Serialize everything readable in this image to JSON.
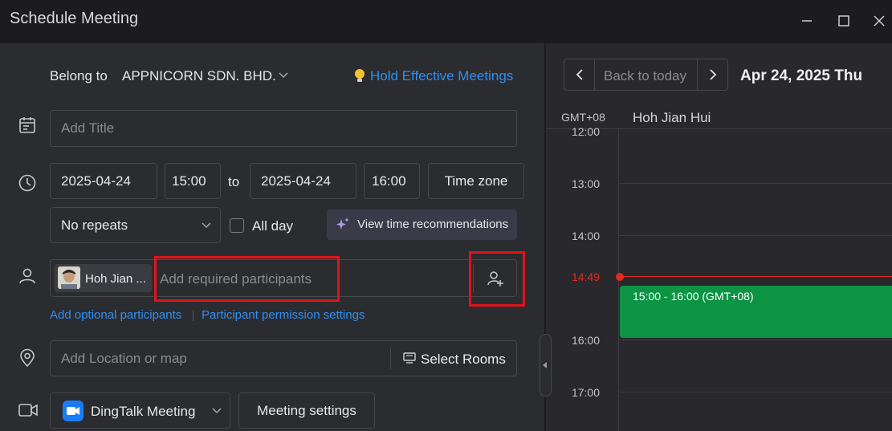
{
  "window": {
    "title": "Schedule Meeting"
  },
  "form": {
    "belong_label": "Belong to",
    "org_name": "APPNICORN SDN. BHD.",
    "tip_link": "Hold Effective Meetings",
    "title_placeholder": "Add Title",
    "start_date": "2025-04-24",
    "start_time": "15:00",
    "to_label": "to",
    "end_date": "2025-04-24",
    "end_time": "16:00",
    "timezone_button": "Time zone",
    "repeat_value": "No repeats",
    "allday_label": "All day",
    "recommend_button": "View time recommendations",
    "participant_chip": "Hoh Jian ...",
    "participants_placeholder": "Add required participants",
    "optional_link": "Add optional participants",
    "permission_link": "Participant permission settings",
    "location_placeholder": "Add Location or map",
    "rooms_button": "Select Rooms",
    "meeting_app": "DingTalk Meeting",
    "meeting_settings": "Meeting settings"
  },
  "calendar": {
    "back_today": "Back to today",
    "date_title": "Apr 24, 2025 Thu",
    "timezone": "GMT+08",
    "person": "Hoh Jian Hui",
    "hours": [
      "12:00",
      "13:00",
      "14:00",
      "16:00",
      "17:00"
    ],
    "now_label": "14:49",
    "event_label": "15:00 - 16:00 (GMT+08)",
    "event_color": "#0c9444",
    "now_color": "#e02a20"
  }
}
